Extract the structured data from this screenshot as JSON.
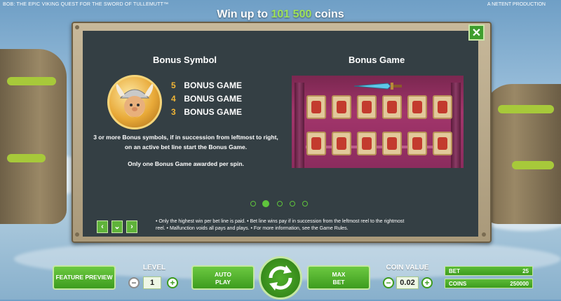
{
  "top": {
    "game_title": "BOB: THE EPIC VIKING QUEST FOR THE SWORD OF TULLEMUTT™",
    "producer": "A NETENT PRODUCTION",
    "win_prefix": "Win up to",
    "win_amount": "101 500",
    "win_suffix": "coins"
  },
  "panel": {
    "close_label": "✕",
    "bonus_symbol": {
      "title": "Bonus Symbol",
      "payouts": [
        {
          "count": "5",
          "label": "BONUS GAME"
        },
        {
          "count": "4",
          "label": "BONUS GAME"
        },
        {
          "count": "3",
          "label": "BONUS GAME"
        }
      ],
      "description": "3 or more Bonus symbols, if in succession from leftmost to right, on an active bet line start the Bonus Game.",
      "note": "Only one Bonus Game awarded per spin."
    },
    "bonus_game": {
      "title": "Bonus Game"
    },
    "pagination": {
      "pages": 5,
      "current": 2
    },
    "nav": {
      "prev": "‹",
      "down": "⌄",
      "next": "›"
    },
    "rules": {
      "left_1": "•   Only the highest win per bet line is paid.   •   Bet line wins pay if in succession from the leftmost reel to the rightmost",
      "left_2": "reel.   •   Malfunction voids all pays and plays.   •   For more information, see the Game Rules."
    }
  },
  "controls": {
    "feature_preview": "FEATURE PREVIEW",
    "level_label": "LEVEL",
    "level_value": "1",
    "minus": "−",
    "plus": "+",
    "auto_play_1": "AUTO",
    "auto_play_2": "PLAY",
    "max_bet_1": "MAX",
    "max_bet_2": "BET",
    "coin_value_label": "COIN VALUE",
    "coin_value": "0.02",
    "bet_label": "BET",
    "bet_value": "25",
    "coins_label": "COINS",
    "coins_value": "250000"
  },
  "colors": {
    "accent_green": "#3d9c1e",
    "payout_count": "#f2b636",
    "win_amount": "#9fe25a",
    "panel_bg": "#343f44"
  }
}
